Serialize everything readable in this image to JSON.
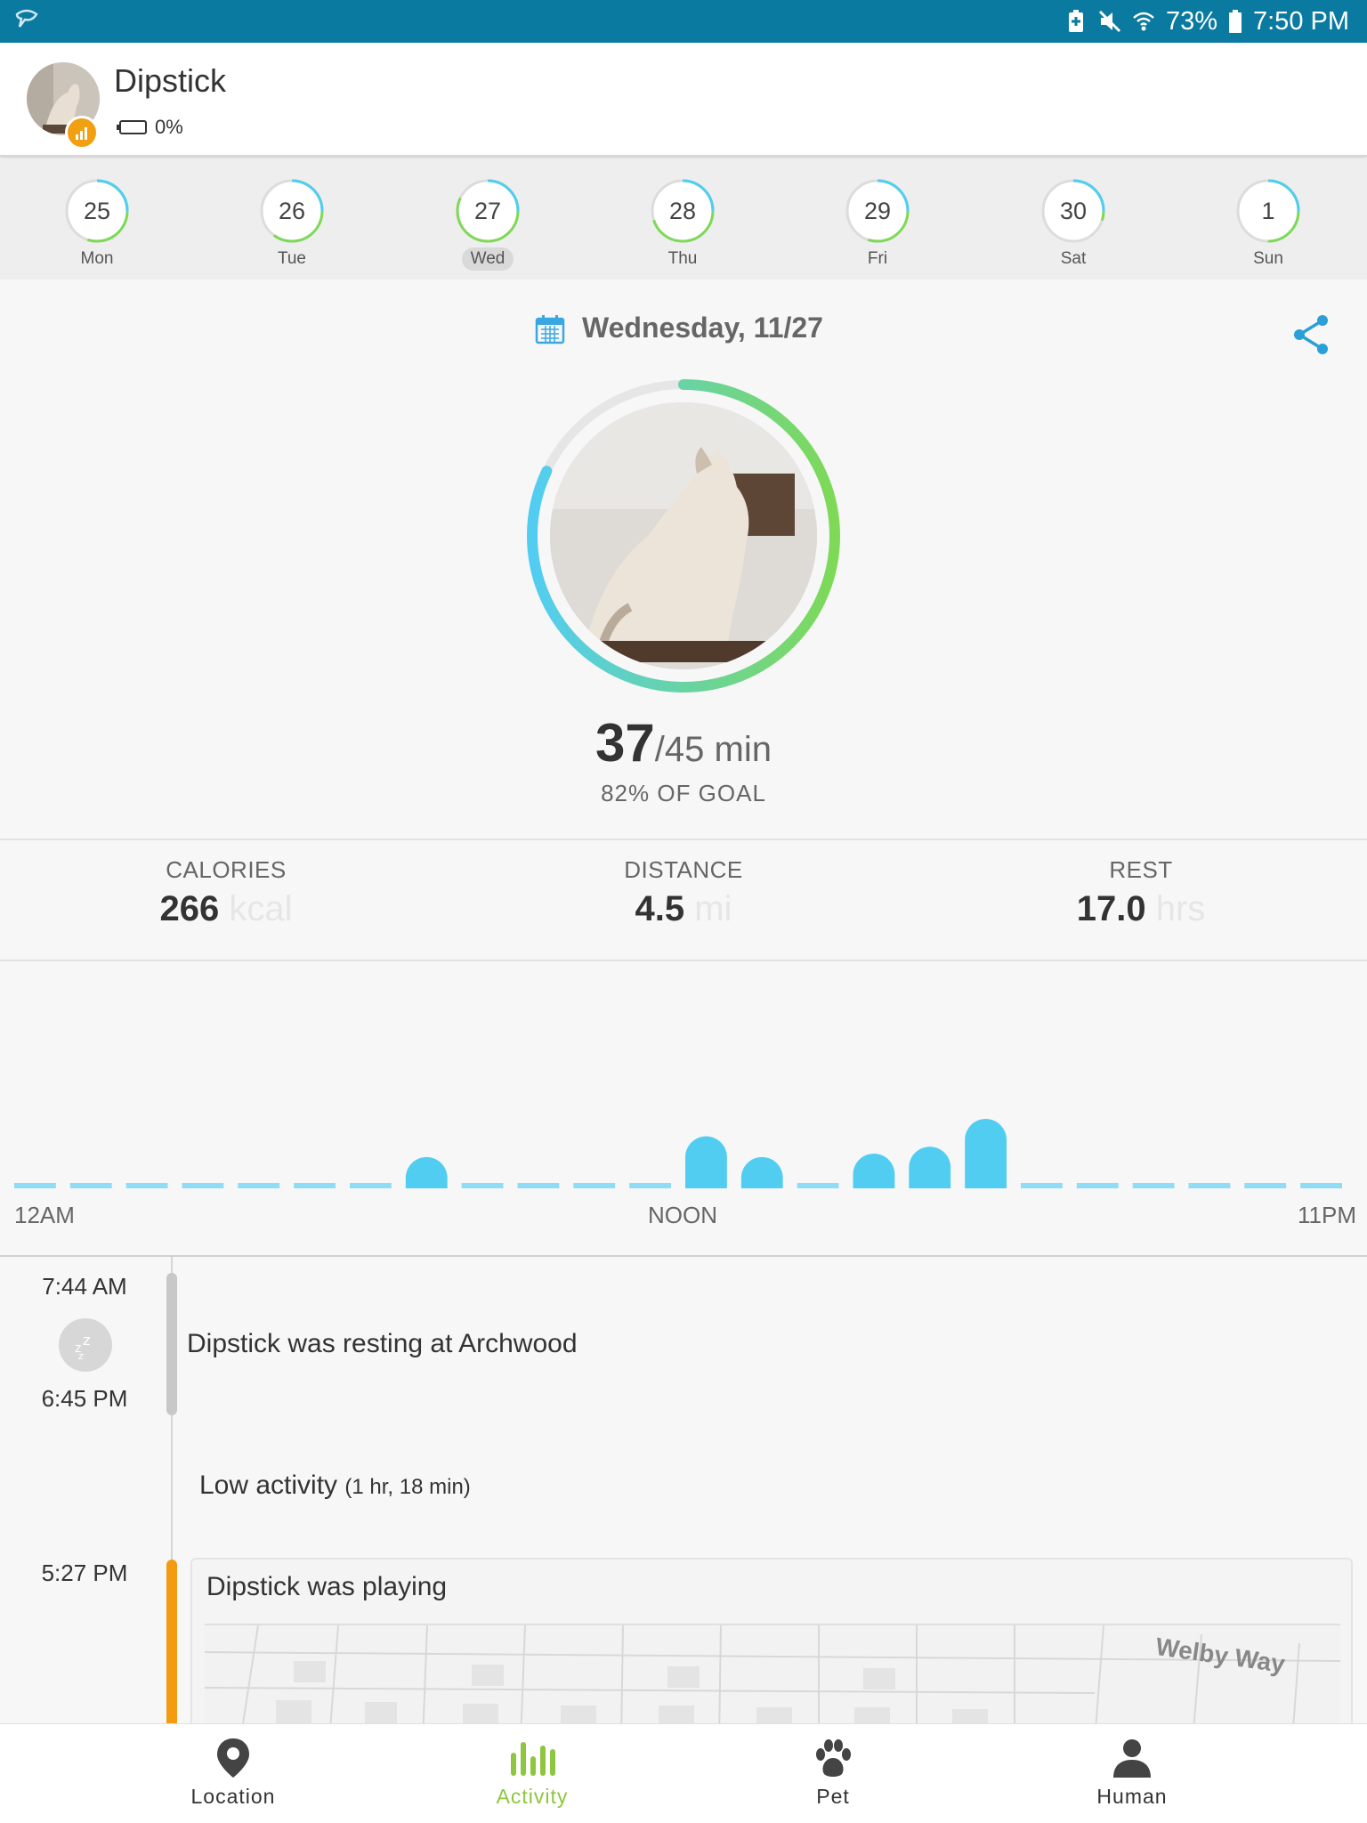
{
  "status_bar": {
    "battery_percent": "73%",
    "time": "7:50 PM"
  },
  "header": {
    "pet_name": "Dipstick",
    "device_battery": "0%"
  },
  "week": [
    {
      "num": "25",
      "label": "Mon",
      "progress": 0.55,
      "selected": false
    },
    {
      "num": "26",
      "label": "Tue",
      "progress": 0.6,
      "selected": false
    },
    {
      "num": "27",
      "label": "Wed",
      "progress": 0.82,
      "selected": true
    },
    {
      "num": "28",
      "label": "Thu",
      "progress": 0.7,
      "selected": false
    },
    {
      "num": "29",
      "label": "Fri",
      "progress": 0.55,
      "selected": false
    },
    {
      "num": "30",
      "label": "Sat",
      "progress": 0.3,
      "selected": false
    },
    {
      "num": "1",
      "label": "Sun",
      "progress": 0.5,
      "selected": false
    }
  ],
  "summary": {
    "date": "Wednesday, 11/27",
    "active_minutes": "37",
    "goal_text": "/45 min",
    "goal_percent_text": "82% OF GOAL",
    "goal_fraction": 0.82
  },
  "stats": {
    "calories_label": "CALORIES",
    "calories_value": "266",
    "calories_unit": "kcal",
    "distance_label": "DISTANCE",
    "distance_value": "4.5",
    "distance_unit": "mi",
    "rest_label": "REST",
    "rest_value": "17.0",
    "rest_unit": "hrs"
  },
  "chart_data": {
    "type": "bar",
    "title": "",
    "x_labels": [
      "12AM",
      "NOON",
      "11PM"
    ],
    "hours": [
      0,
      1,
      2,
      3,
      4,
      5,
      6,
      7,
      8,
      9,
      10,
      11,
      12,
      13,
      14,
      15,
      16,
      17,
      18,
      19,
      20,
      21,
      22,
      23
    ],
    "values": [
      0,
      0,
      0,
      0,
      0,
      0,
      0,
      0.45,
      0,
      0,
      0,
      0,
      0.75,
      0.45,
      0,
      0.5,
      0.6,
      1,
      0,
      0,
      0,
      0,
      0,
      0
    ],
    "ylim": [
      0,
      1
    ],
    "color": "#52cdf2"
  },
  "timeline": {
    "rest_start": "7:44 AM",
    "rest_end": "6:45 PM",
    "rest_text": "Dipstick was resting at Archwood",
    "low_text": "Low activity",
    "low_duration": "(1 hr, 18 min)",
    "play_time": "5:27 PM",
    "play_text": "Dipstick was playing",
    "map_street": "Welby Way",
    "play_color": "#f39c12"
  },
  "nav": {
    "location": "Location",
    "activity": "Activity",
    "pet": "Pet",
    "human": "Human",
    "active_color": "#8ec63f"
  }
}
